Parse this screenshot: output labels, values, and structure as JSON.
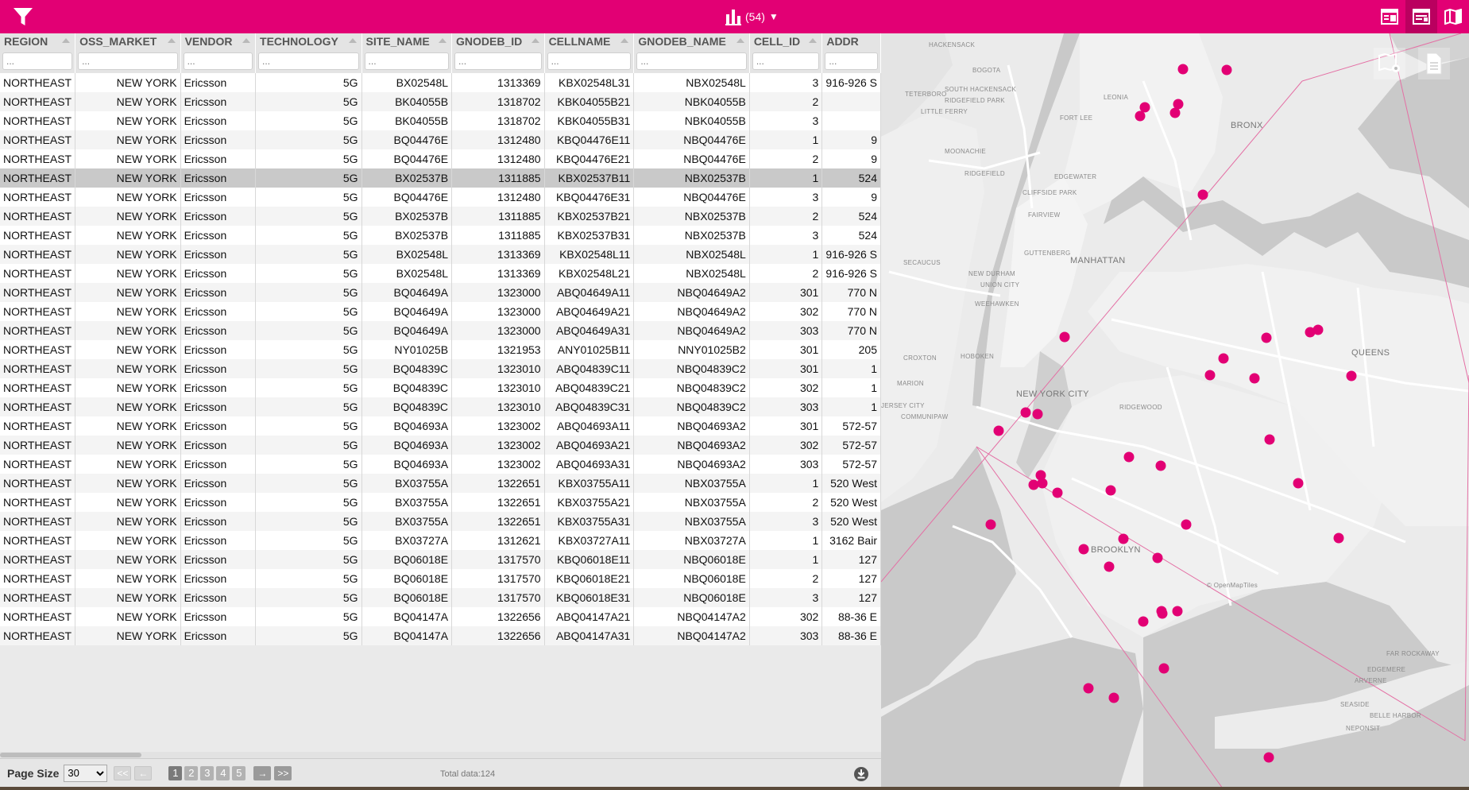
{
  "header": {
    "site_count": "(54)",
    "colors": {
      "brand": "#e20074",
      "brand_dark": "#ba005f",
      "marker": "#e20074"
    }
  },
  "grid": {
    "columns": [
      {
        "key": "REGION",
        "label": "REGION"
      },
      {
        "key": "OSS_MARKET",
        "label": "OSS_MARKET"
      },
      {
        "key": "VENDOR",
        "label": "VENDOR"
      },
      {
        "key": "TECHNOLOGY",
        "label": "TECHNOLOGY"
      },
      {
        "key": "SITE_NAME",
        "label": "SITE_NAME"
      },
      {
        "key": "GNODEB_ID",
        "label": "GNODEB_ID"
      },
      {
        "key": "CELLNAME",
        "label": "CELLNAME"
      },
      {
        "key": "GNODEB_NAME",
        "label": "GNODEB_NAME"
      },
      {
        "key": "CELL_ID",
        "label": "CELL_ID"
      },
      {
        "key": "ADDR",
        "label": "ADDR"
      }
    ],
    "filter_placeholder": "...",
    "selected_row": 5,
    "rows": [
      [
        "NORTHEAST",
        "NEW YORK",
        "Ericsson",
        "5G",
        "BX02548L",
        "1313369",
        "KBX02548L31",
        "NBX02548L",
        "3",
        "916-926 S"
      ],
      [
        "NORTHEAST",
        "NEW YORK",
        "Ericsson",
        "5G",
        "BK04055B",
        "1318702",
        "KBK04055B21",
        "NBK04055B",
        "2",
        ""
      ],
      [
        "NORTHEAST",
        "NEW YORK",
        "Ericsson",
        "5G",
        "BK04055B",
        "1318702",
        "KBK04055B31",
        "NBK04055B",
        "3",
        ""
      ],
      [
        "NORTHEAST",
        "NEW YORK",
        "Ericsson",
        "5G",
        "BQ04476E",
        "1312480",
        "KBQ04476E11",
        "NBQ04476E",
        "1",
        "9"
      ],
      [
        "NORTHEAST",
        "NEW YORK",
        "Ericsson",
        "5G",
        "BQ04476E",
        "1312480",
        "KBQ04476E21",
        "NBQ04476E",
        "2",
        "9"
      ],
      [
        "NORTHEAST",
        "NEW YORK",
        "Ericsson",
        "5G",
        "BX02537B",
        "1311885",
        "KBX02537B11",
        "NBX02537B",
        "1",
        "524"
      ],
      [
        "NORTHEAST",
        "NEW YORK",
        "Ericsson",
        "5G",
        "BQ04476E",
        "1312480",
        "KBQ04476E31",
        "NBQ04476E",
        "3",
        "9"
      ],
      [
        "NORTHEAST",
        "NEW YORK",
        "Ericsson",
        "5G",
        "BX02537B",
        "1311885",
        "KBX02537B21",
        "NBX02537B",
        "2",
        "524"
      ],
      [
        "NORTHEAST",
        "NEW YORK",
        "Ericsson",
        "5G",
        "BX02537B",
        "1311885",
        "KBX02537B31",
        "NBX02537B",
        "3",
        "524"
      ],
      [
        "NORTHEAST",
        "NEW YORK",
        "Ericsson",
        "5G",
        "BX02548L",
        "1313369",
        "KBX02548L11",
        "NBX02548L",
        "1",
        "916-926 S"
      ],
      [
        "NORTHEAST",
        "NEW YORK",
        "Ericsson",
        "5G",
        "BX02548L",
        "1313369",
        "KBX02548L21",
        "NBX02548L",
        "2",
        "916-926 S"
      ],
      [
        "NORTHEAST",
        "NEW YORK",
        "Ericsson",
        "5G",
        "BQ04649A",
        "1323000",
        "ABQ04649A11",
        "NBQ04649A2",
        "301",
        "770 N"
      ],
      [
        "NORTHEAST",
        "NEW YORK",
        "Ericsson",
        "5G",
        "BQ04649A",
        "1323000",
        "ABQ04649A21",
        "NBQ04649A2",
        "302",
        "770 N"
      ],
      [
        "NORTHEAST",
        "NEW YORK",
        "Ericsson",
        "5G",
        "BQ04649A",
        "1323000",
        "ABQ04649A31",
        "NBQ04649A2",
        "303",
        "770 N"
      ],
      [
        "NORTHEAST",
        "NEW YORK",
        "Ericsson",
        "5G",
        "NY01025B",
        "1321953",
        "ANY01025B11",
        "NNY01025B2",
        "301",
        "205"
      ],
      [
        "NORTHEAST",
        "NEW YORK",
        "Ericsson",
        "5G",
        "BQ04839C",
        "1323010",
        "ABQ04839C11",
        "NBQ04839C2",
        "301",
        "1"
      ],
      [
        "NORTHEAST",
        "NEW YORK",
        "Ericsson",
        "5G",
        "BQ04839C",
        "1323010",
        "ABQ04839C21",
        "NBQ04839C2",
        "302",
        "1"
      ],
      [
        "NORTHEAST",
        "NEW YORK",
        "Ericsson",
        "5G",
        "BQ04839C",
        "1323010",
        "ABQ04839C31",
        "NBQ04839C2",
        "303",
        "1"
      ],
      [
        "NORTHEAST",
        "NEW YORK",
        "Ericsson",
        "5G",
        "BQ04693A",
        "1323002",
        "ABQ04693A11",
        "NBQ04693A2",
        "301",
        "572-57"
      ],
      [
        "NORTHEAST",
        "NEW YORK",
        "Ericsson",
        "5G",
        "BQ04693A",
        "1323002",
        "ABQ04693A21",
        "NBQ04693A2",
        "302",
        "572-57"
      ],
      [
        "NORTHEAST",
        "NEW YORK",
        "Ericsson",
        "5G",
        "BQ04693A",
        "1323002",
        "ABQ04693A31",
        "NBQ04693A2",
        "303",
        "572-57"
      ],
      [
        "NORTHEAST",
        "NEW YORK",
        "Ericsson",
        "5G",
        "BX03755A",
        "1322651",
        "KBX03755A11",
        "NBX03755A",
        "1",
        "520 West"
      ],
      [
        "NORTHEAST",
        "NEW YORK",
        "Ericsson",
        "5G",
        "BX03755A",
        "1322651",
        "KBX03755A21",
        "NBX03755A",
        "2",
        "520 West"
      ],
      [
        "NORTHEAST",
        "NEW YORK",
        "Ericsson",
        "5G",
        "BX03755A",
        "1322651",
        "KBX03755A31",
        "NBX03755A",
        "3",
        "520 West"
      ],
      [
        "NORTHEAST",
        "NEW YORK",
        "Ericsson",
        "5G",
        "BX03727A",
        "1312621",
        "KBX03727A11",
        "NBX03727A",
        "1",
        "3162 Bair"
      ],
      [
        "NORTHEAST",
        "NEW YORK",
        "Ericsson",
        "5G",
        "BQ06018E",
        "1317570",
        "KBQ06018E11",
        "NBQ06018E",
        "1",
        "127"
      ],
      [
        "NORTHEAST",
        "NEW YORK",
        "Ericsson",
        "5G",
        "BQ06018E",
        "1317570",
        "KBQ06018E21",
        "NBQ06018E",
        "2",
        "127"
      ],
      [
        "NORTHEAST",
        "NEW YORK",
        "Ericsson",
        "5G",
        "BQ06018E",
        "1317570",
        "KBQ06018E31",
        "NBQ06018E",
        "3",
        "127"
      ],
      [
        "NORTHEAST",
        "NEW YORK",
        "Ericsson",
        "5G",
        "BQ04147A",
        "1322656",
        "ABQ04147A21",
        "NBQ04147A2",
        "302",
        "88-36 E"
      ],
      [
        "NORTHEAST",
        "NEW YORK",
        "Ericsson",
        "5G",
        "BQ04147A",
        "1322656",
        "ABQ04147A31",
        "NBQ04147A2",
        "303",
        "88-36 E"
      ]
    ]
  },
  "pager": {
    "page_size_label": "Page Size",
    "page_size": "30",
    "page_size_options": [
      "30"
    ],
    "first": "<<",
    "prev": "←",
    "pages": [
      "1",
      "2",
      "3",
      "4",
      "5"
    ],
    "current_page": "1",
    "next": "→",
    "last": ">>",
    "total": "Total data:124"
  },
  "map": {
    "labels": [
      "HACKENSACK",
      "BOGOTA",
      "SOUTH HACKENSACK",
      "TETERBORO",
      "RIDGEFIELD PARK",
      "LITTLE FERRY",
      "LEONIA",
      "FORT LEE",
      "MOONACHIE",
      "RIDGEFIELD",
      "EDGEWATER",
      "CLIFFSIDE PARK",
      "FAIRVIEW",
      "GUTTENBERG",
      "MANHATTAN",
      "SECAUCUS",
      "NEW DURHAM",
      "UNION CITY",
      "WEEHAWKEN",
      "HOBOKEN",
      "NEW YORK CITY",
      "CROXTON",
      "MARION",
      "JERSEY CITY",
      "COMMUNIPAW",
      "BRONX",
      "QUEENS",
      "BROOKLYN",
      "FAR ROCKAWAY",
      "EDGEMERE",
      "ARVERNE",
      "SEASIDE",
      "BELLE HARBOR",
      "NEPONSIT",
      "RIDGEWOOD",
      "© OpenMapTiles"
    ]
  }
}
